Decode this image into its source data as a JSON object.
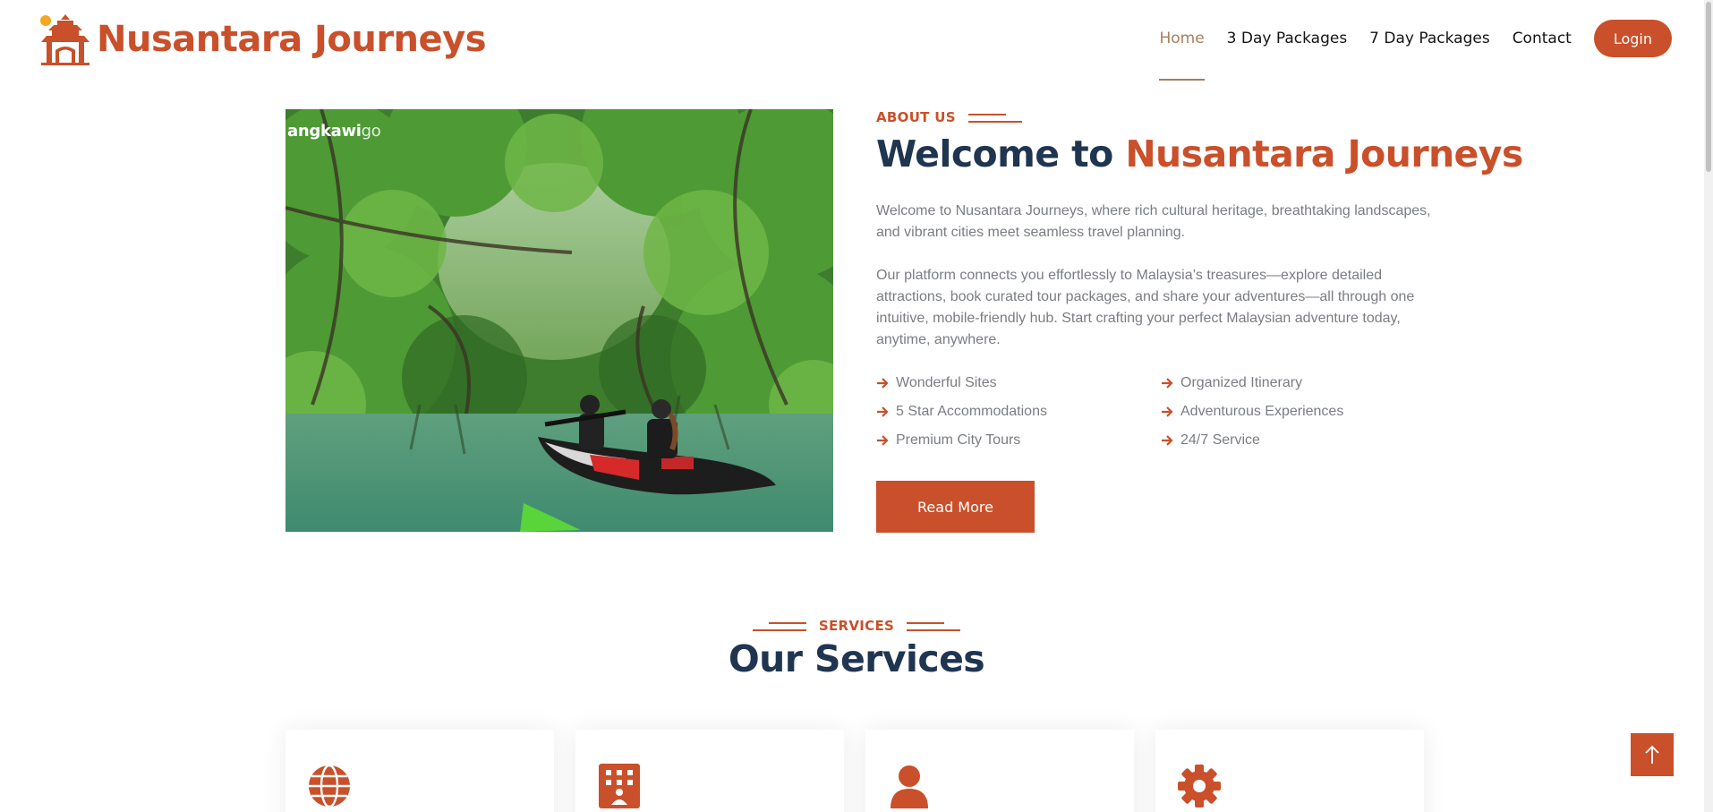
{
  "brand": {
    "name": "Nusantara Journeys",
    "logo_icon": "pagoda-gate-logo-icon",
    "color": "#c9502a"
  },
  "nav": {
    "items": [
      {
        "label": "Home",
        "active": true
      },
      {
        "label": "3 Day Packages",
        "active": false
      },
      {
        "label": "7 Day Packages",
        "active": false
      },
      {
        "label": "Contact",
        "active": false
      }
    ],
    "login_label": "Login"
  },
  "about": {
    "image_watermark": "angkawi",
    "image_watermark_suffix": "go",
    "tag": "ABOUT US",
    "title_prefix": "Welcome to ",
    "title_accent": "Nusantara Journeys",
    "paragraphs": [
      "Welcome to Nusantara Journeys, where rich cultural heritage, breathtaking landscapes, and vibrant cities meet seamless travel planning.",
      "Our platform connects you effortlessly to Malaysia’s treasures—explore detailed attractions, book curated tour packages, and share your adventures—all through one intuitive, mobile-friendly hub. Start crafting your perfect Malaysian adventure today, anytime, anywhere."
    ],
    "features": [
      "Wonderful Sites",
      "Organized Itinerary",
      "5 Star Accommodations",
      "Adventurous Experiences",
      "Premium City Tours",
      "24/7 Service"
    ],
    "read_more_label": "Read More"
  },
  "services": {
    "tag": "SERVICES",
    "title": "Our Services",
    "cards": [
      {
        "icon": "globe-icon"
      },
      {
        "icon": "hotel-icon"
      },
      {
        "icon": "user-icon"
      },
      {
        "icon": "gear-icon"
      }
    ]
  },
  "colors": {
    "accent": "#c9502a",
    "heading": "#1f3550",
    "body_text": "#7a7d82",
    "nav_active": "#a97e5b"
  },
  "back_to_top_icon": "arrow-up-icon"
}
